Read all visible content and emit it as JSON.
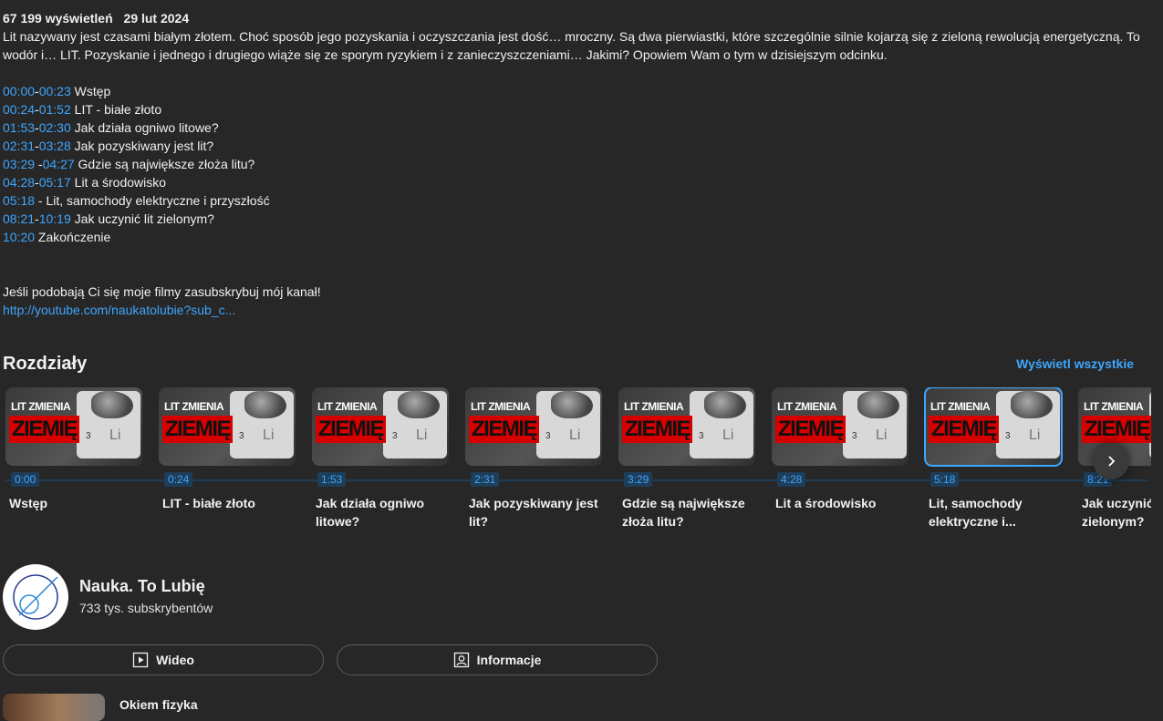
{
  "description": {
    "views": "67 199 wyświetleń",
    "date": "29 lut 2024",
    "text": "Lit nazywany jest czasami białym złotem. Choć sposób jego pozyskania i oczyszczania jest dość… mroczny. Są dwa pierwiastki, które szczególnie silnie kojarzą się z zieloną rewolucją energetyczną. To wodór i… LIT. Pozyskanie i jednego i drugiego wiąże się ze sporym ryzykiem i z zanieczyszczeniami… Jakimi? Opowiem Wam o tym w dzisiejszym odcinku.",
    "timestamps": [
      {
        "start": "00:00",
        "sep": "-",
        "end": "00:23",
        "label": " Wstęp"
      },
      {
        "start": "00:24",
        "sep": "-",
        "end": "01:52",
        "label": " LIT - białe złoto"
      },
      {
        "start": "01:53",
        "sep": "-",
        "end": "02:30",
        "label": " Jak działa ogniwo litowe?"
      },
      {
        "start": "02:31",
        "sep": "-",
        "end": "03:28",
        "label": " Jak pozyskiwany jest lit?"
      },
      {
        "start": "03:29",
        "sep": " -",
        "end": "04:27",
        "label": " Gdzie są największe złoża litu?"
      },
      {
        "start": "04:28",
        "sep": "-",
        "end": "05:17",
        "label": " Lit a środowisko"
      },
      {
        "start": "05:18",
        "sep": "",
        "end": "",
        "label": " - Lit, samochody elektryczne i przyszłość"
      },
      {
        "start": "08:21",
        "sep": "-",
        "end": "10:19",
        "label": " Jak uczynić lit zielonym?"
      },
      {
        "start": "10:20",
        "sep": "",
        "end": "",
        "label": " Zakończenie"
      }
    ],
    "subscribe_text": "Jeśli podobają Ci się moje filmy zasubskrybuj mój kanał!",
    "subscribe_link": "http://youtube.com/naukatolubie?sub_c..."
  },
  "chapters": {
    "heading": "Rozdziały",
    "view_all": "Wyświetl wszystkie",
    "thumb_text_top": "LIT ZMIENIA",
    "thumb_text_main": "ZIEMIĘ",
    "thumb_element_number": "3",
    "thumb_element_symbol": "Li",
    "active_index": 6,
    "items": [
      {
        "time": "0:00",
        "title": "Wstęp"
      },
      {
        "time": "0:24",
        "title": "LIT - białe złoto"
      },
      {
        "time": "1:53",
        "title": "Jak działa ogniwo litowe?"
      },
      {
        "time": "2:31",
        "title": "Jak pozyskiwany jest lit?"
      },
      {
        "time": "3:29",
        "title": "Gdzie są największe złoża litu?"
      },
      {
        "time": "4:28",
        "title": "Lit a środowisko"
      },
      {
        "time": "5:18",
        "title": "Lit, samochody elektryczne i..."
      },
      {
        "time": "8:21",
        "title": "Jak uczynić zielonym?"
      }
    ],
    "next_icon": "chevron-right-icon"
  },
  "channel": {
    "name": "Nauka. To Lubię",
    "subscribers": "733 tys. subskrybentów",
    "videos_button": "Wideo",
    "about_button": "Informacje"
  },
  "next_section": {
    "title": "Okiem fizyka"
  },
  "colors": {
    "background": "#272727",
    "link": "#3ea6ff",
    "thumb_red": "#d60000"
  }
}
